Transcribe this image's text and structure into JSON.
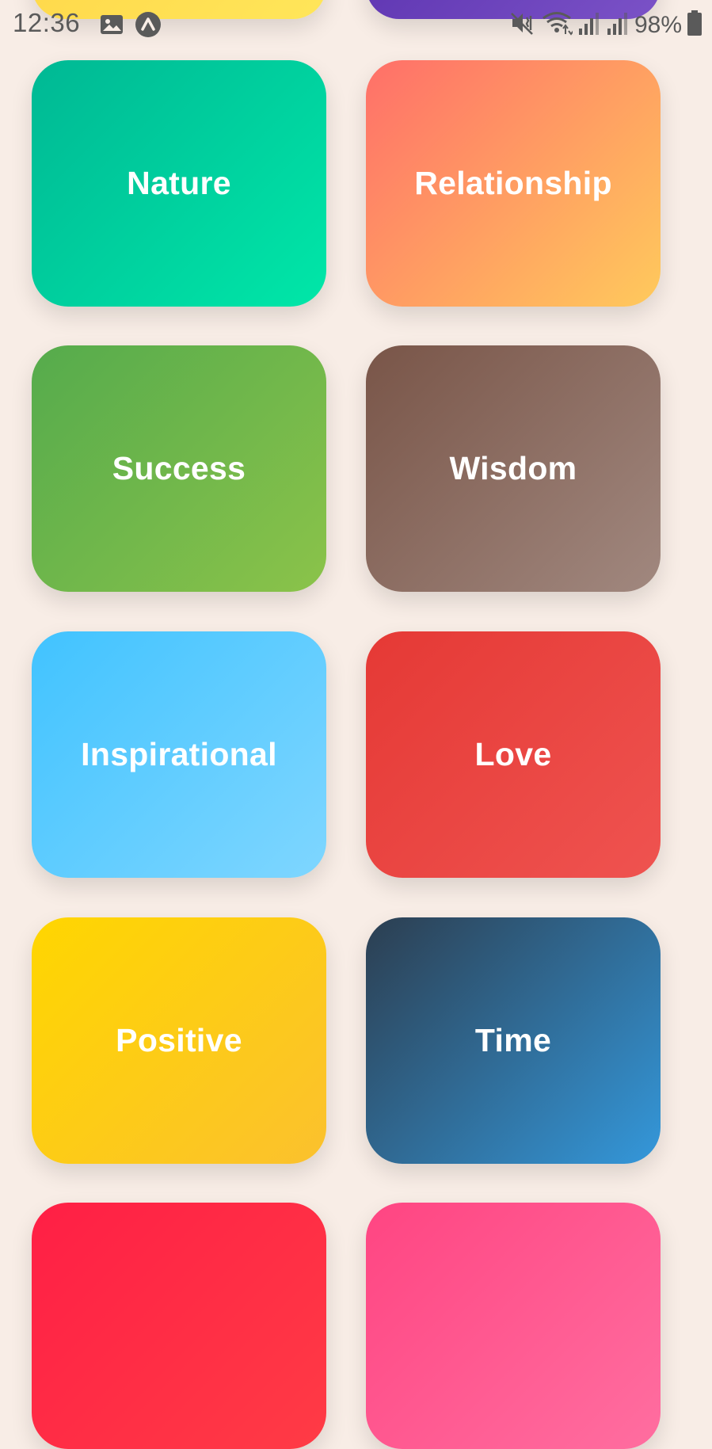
{
  "status_bar": {
    "time": "12:36",
    "left_icons": [
      "image-icon",
      "app-notification-icon"
    ],
    "right_icons": [
      "mute-vibrate-icon",
      "wifi-icon",
      "signal-icon",
      "signal-icon-2",
      "battery-icon"
    ],
    "battery": "98%"
  },
  "categories": [
    {
      "label": "Nature",
      "colors": [
        "#00b894",
        "#00e7a8"
      ]
    },
    {
      "label": "Relationship",
      "colors": [
        "#ff6f69",
        "#ffca5c"
      ]
    },
    {
      "label": "Success",
      "colors": [
        "#55ab4c",
        "#8bc34a"
      ]
    },
    {
      "label": "Wisdom",
      "colors": [
        "#795548",
        "#a1887f"
      ]
    },
    {
      "label": "Inspirational",
      "colors": [
        "#41c3ff",
        "#7fd6ff"
      ]
    },
    {
      "label": "Love",
      "colors": [
        "#e53935",
        "#ef5350"
      ]
    },
    {
      "label": "Positive",
      "colors": [
        "#ffd600",
        "#fbc12e"
      ]
    },
    {
      "label": "Time",
      "colors": [
        "#2c3e50",
        "#3498db"
      ]
    }
  ],
  "colors": {
    "background": "#f8ede6",
    "status_text": "#5a5a5a"
  }
}
